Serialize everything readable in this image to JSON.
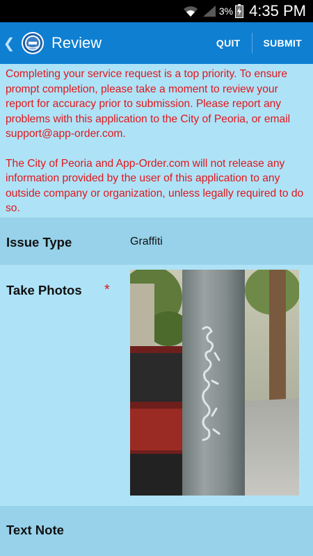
{
  "status_bar": {
    "battery_percent": "3%",
    "time": "4:35 PM"
  },
  "action_bar": {
    "title": "Review",
    "quit_label": "QUIT",
    "submit_label": "SUBMIT"
  },
  "notice": {
    "paragraph1": "Completing your service request is a top priority. To ensure prompt completion, please take a moment to review your report for accuracy prior to submission. Please report any problems with this application to the City of Peoria, or email support@app-order.com.",
    "paragraph2": "The City of Peoria and App-Order.com will not release any information provided by the user of this application to any outside company or organization, unless legally required to do so."
  },
  "fields": {
    "issue_type": {
      "label": "Issue Type",
      "value": "Graffiti"
    },
    "take_photos": {
      "label": "Take Photos",
      "required_mark": "*"
    },
    "text_note": {
      "label": "Text Note"
    }
  },
  "colors": {
    "action_bar": "#0e7fd1",
    "notice_text": "#e0161c",
    "background": "#aee3f7",
    "row_alt": "#97d2ea"
  }
}
